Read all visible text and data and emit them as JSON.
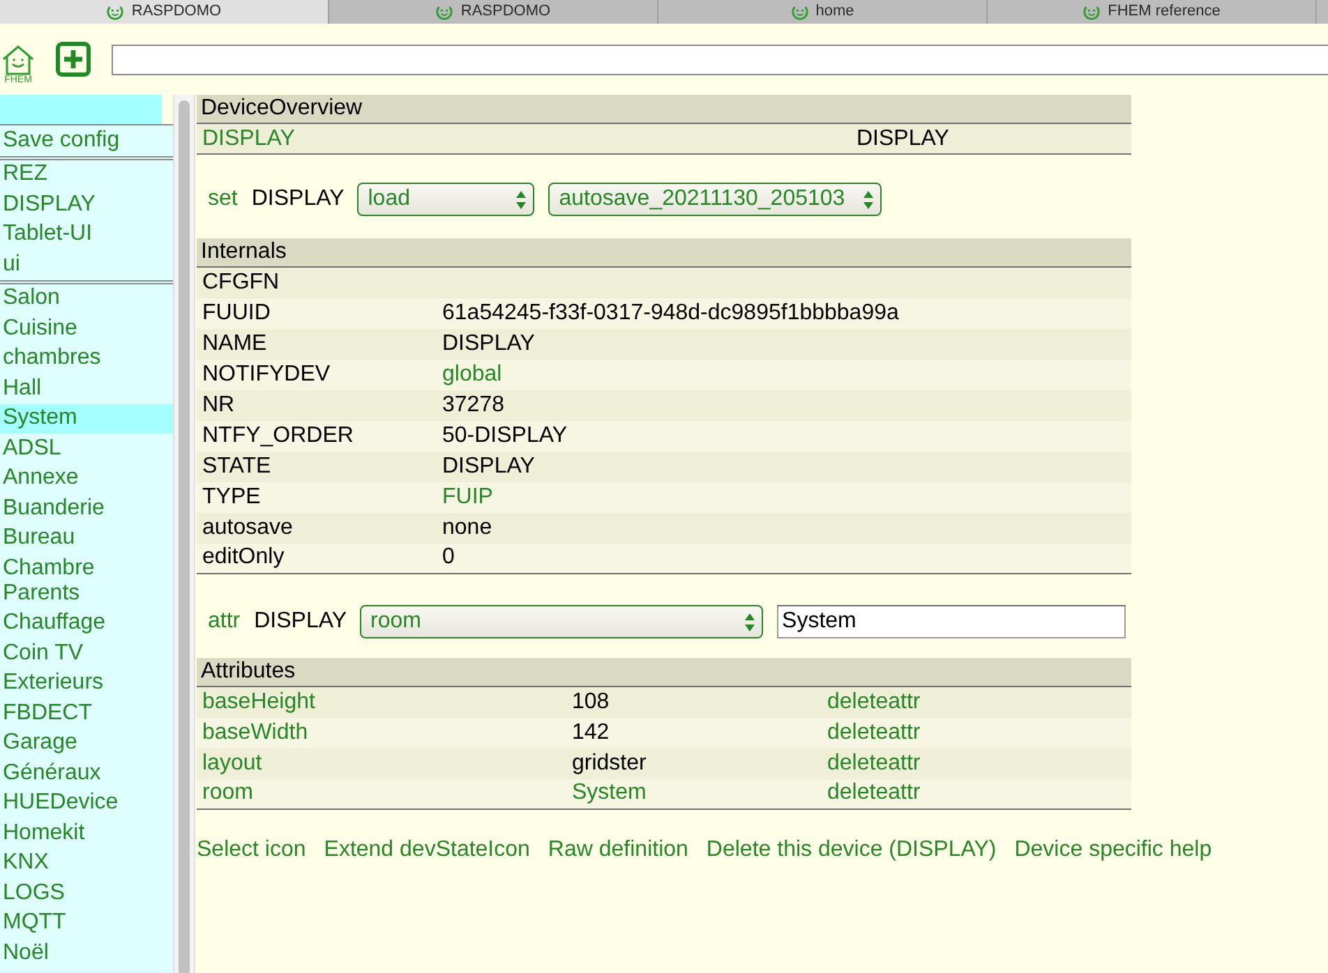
{
  "browser_tabs": [
    {
      "label": "RASPDOMO",
      "selected": true
    },
    {
      "label": "RASPDOMO",
      "selected": false
    },
    {
      "label": "home",
      "selected": false
    },
    {
      "label": "FHEM reference",
      "selected": false
    }
  ],
  "header": {
    "logo_text": "FHEM"
  },
  "menu": {
    "groups": [
      {
        "items": [
          {
            "label": "Save config",
            "selected": false
          }
        ]
      },
      {
        "items": [
          {
            "label": "REZ",
            "selected": false
          },
          {
            "label": "DISPLAY",
            "selected": false
          },
          {
            "label": "Tablet-UI",
            "selected": false
          },
          {
            "label": "ui",
            "selected": false
          }
        ]
      },
      {
        "items": [
          {
            "label": "Salon",
            "selected": false
          },
          {
            "label": "Cuisine",
            "selected": false
          },
          {
            "label": "chambres",
            "selected": false
          },
          {
            "label": "Hall",
            "selected": false
          },
          {
            "label": "System",
            "selected": true
          },
          {
            "label": "ADSL",
            "selected": false
          },
          {
            "label": "Annexe",
            "selected": false
          },
          {
            "label": "Buanderie",
            "selected": false
          },
          {
            "label": "Bureau",
            "selected": false
          },
          {
            "label": "Chambre Parents",
            "selected": false
          },
          {
            "label": "Chauffage",
            "selected": false
          },
          {
            "label": "Coin TV",
            "selected": false
          },
          {
            "label": "Exterieurs",
            "selected": false
          },
          {
            "label": "FBDECT",
            "selected": false
          },
          {
            "label": "Garage",
            "selected": false
          },
          {
            "label": "Généraux",
            "selected": false
          },
          {
            "label": "HUEDevice",
            "selected": false
          },
          {
            "label": "Homekit",
            "selected": false
          },
          {
            "label": "KNX",
            "selected": false
          },
          {
            "label": "LOGS",
            "selected": false
          },
          {
            "label": "MQTT",
            "selected": false
          },
          {
            "label": "Noël",
            "selected": false
          }
        ]
      }
    ]
  },
  "overview": {
    "title": "DeviceOverview",
    "device": "DISPLAY",
    "state": "DISPLAY"
  },
  "set_command": {
    "label": "set",
    "device": "DISPLAY",
    "command": "load",
    "argument": "autosave_20211130_205103"
  },
  "internals": {
    "title": "Internals",
    "rows": [
      {
        "name": "CFGFN"
      },
      {
        "name": "FUUID",
        "value": "61a54245-f33f-0317-948d-dc9895f1bbbba99a",
        "link": false
      },
      {
        "name": "NAME",
        "value": "DISPLAY",
        "link": false
      },
      {
        "name": "NOTIFYDEV",
        "value": "global",
        "link": true
      },
      {
        "name": "NR",
        "value": "37278",
        "link": false
      },
      {
        "name": "NTFY_ORDER",
        "value": "50-DISPLAY",
        "link": false
      },
      {
        "name": "STATE",
        "value": "DISPLAY",
        "link": false
      },
      {
        "name": "TYPE",
        "value": "FUIP",
        "link": true
      },
      {
        "name": "autosave",
        "value": "none",
        "link": false
      },
      {
        "name": "editOnly",
        "value": "0",
        "link": false
      }
    ]
  },
  "attr_command": {
    "label": "attr",
    "device": "DISPLAY",
    "attribute": "room",
    "value": "System"
  },
  "attributes": {
    "title": "Attributes",
    "rows": [
      {
        "name": "baseHeight",
        "value": "108",
        "link": false,
        "action": "deleteattr"
      },
      {
        "name": "baseWidth",
        "value": "142",
        "link": false,
        "action": "deleteattr"
      },
      {
        "name": "layout",
        "value": "gridster",
        "link": false,
        "action": "deleteattr"
      },
      {
        "name": "room",
        "value": "System",
        "link": true,
        "action": "deleteattr"
      }
    ]
  },
  "actions": [
    "Select icon",
    "Extend devStateIcon",
    "Raw definition",
    "Delete this device (DISPLAY)",
    "Device specific help"
  ]
}
